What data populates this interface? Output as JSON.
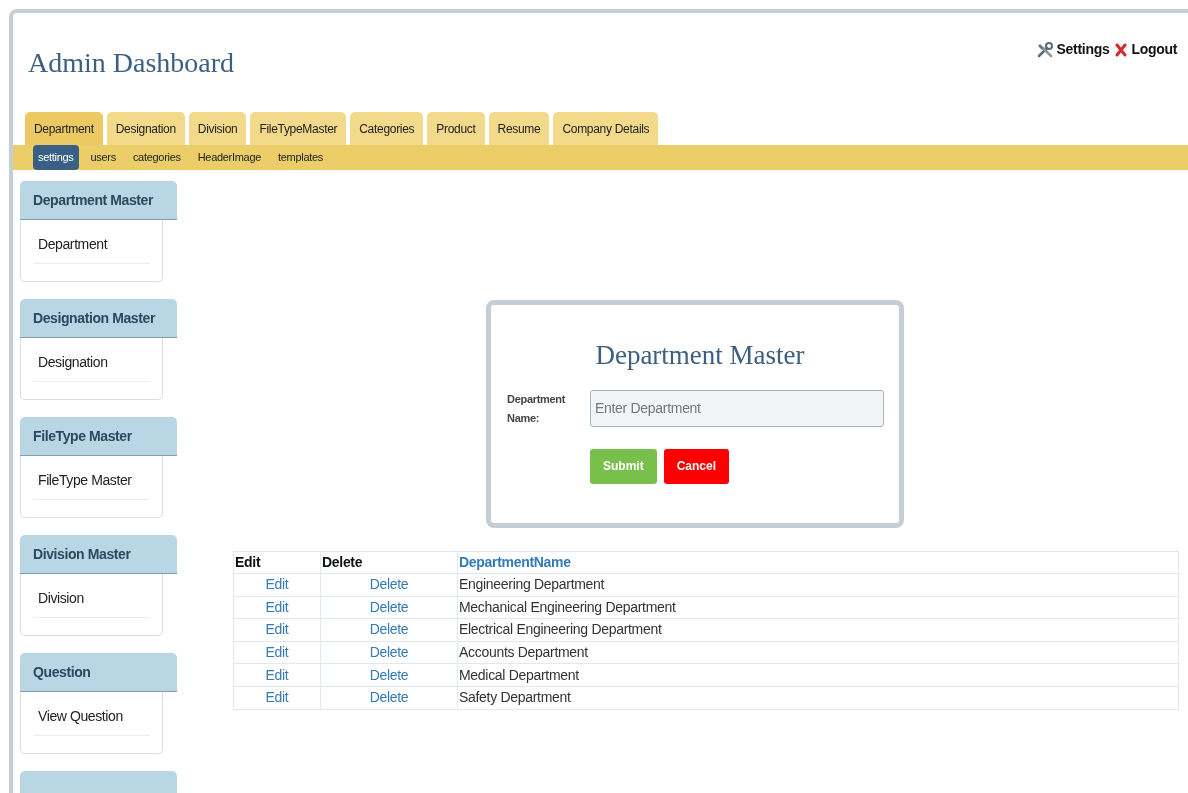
{
  "header": {
    "title": "Admin Dashboard",
    "links": [
      {
        "kind": "settings",
        "label": "Settings"
      },
      {
        "kind": "logout",
        "label": "Logout"
      }
    ]
  },
  "tabs": [
    {
      "label": "Department",
      "selected": true
    },
    {
      "label": "Designation",
      "selected": false
    },
    {
      "label": "Division",
      "selected": false
    },
    {
      "label": "FileTypeMaster",
      "selected": false
    },
    {
      "label": "Categories",
      "selected": false
    },
    {
      "label": "Product",
      "selected": false
    },
    {
      "label": "Resume",
      "selected": false
    },
    {
      "label": "Company Details",
      "selected": false
    }
  ],
  "subtabs": [
    {
      "label": "settings",
      "selected": true
    },
    {
      "label": "users",
      "selected": false
    },
    {
      "label": "categories",
      "selected": false
    },
    {
      "label": "HeaderImage",
      "selected": false
    },
    {
      "label": "templates",
      "selected": false
    }
  ],
  "sidebar": [
    {
      "title": "Department Master",
      "items": [
        "Department"
      ]
    },
    {
      "title": "Designation Master",
      "items": [
        "Designation"
      ]
    },
    {
      "title": "FileType Master",
      "items": [
        "FileType Master"
      ]
    },
    {
      "title": "Division Master",
      "items": [
        "Division"
      ]
    },
    {
      "title": "Question",
      "items": [
        "View Question"
      ]
    }
  ],
  "form": {
    "title": "Department Master",
    "field_label": "Department Name:",
    "placeholder": "Enter Department",
    "buttons": [
      {
        "kind": "submit",
        "label": "Submit"
      },
      {
        "kind": "cancel",
        "label": "Cancel"
      }
    ]
  },
  "table": {
    "columns": [
      "Edit",
      "Delete",
      "DepartmentName"
    ],
    "rows": [
      {
        "edit": "Edit",
        "delete": "Delete",
        "name": "Engineering Department"
      },
      {
        "edit": "Edit",
        "delete": "Delete",
        "name": "Mechanical Engineering Department"
      },
      {
        "edit": "Edit",
        "delete": "Delete",
        "name": "Electrical Engineering Department"
      },
      {
        "edit": "Edit",
        "delete": "Delete",
        "name": "Accounts Department"
      },
      {
        "edit": "Edit",
        "delete": "Delete",
        "name": "Medical Department"
      },
      {
        "edit": "Edit",
        "delete": "Delete",
        "name": "Safety Department"
      }
    ]
  }
}
